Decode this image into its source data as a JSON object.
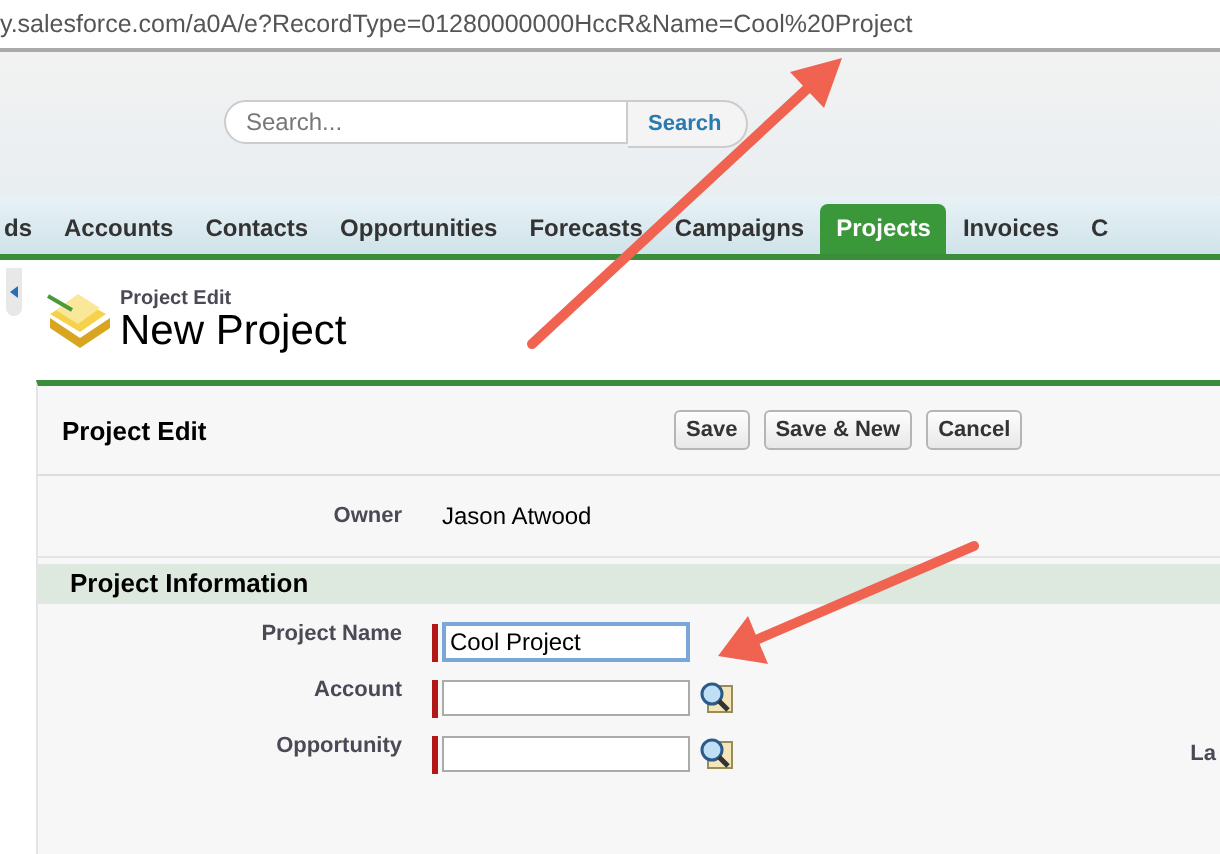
{
  "address_bar": {
    "url": "y.salesforce.com/a0A/e?RecordType=01280000000HccR&Name=Cool%20Project"
  },
  "search": {
    "placeholder": "Search...",
    "button": "Search"
  },
  "tabs": [
    {
      "label": "ds",
      "selected": false
    },
    {
      "label": "Accounts",
      "selected": false
    },
    {
      "label": "Contacts",
      "selected": false
    },
    {
      "label": "Opportunities",
      "selected": false
    },
    {
      "label": "Forecasts",
      "selected": false
    },
    {
      "label": "Campaigns",
      "selected": false
    },
    {
      "label": "Projects",
      "selected": true
    },
    {
      "label": "Invoices",
      "selected": false
    },
    {
      "label": "C",
      "selected": false
    }
  ],
  "page_header": {
    "subtitle": "Project Edit",
    "title": "New Project"
  },
  "edit_panel": {
    "title": "Project Edit",
    "buttons": [
      "Save",
      "Save & New",
      "Cancel"
    ],
    "owner": {
      "label": "Owner",
      "value": "Jason Atwood"
    },
    "section": {
      "title": "Project Information",
      "fields": [
        {
          "label": "Project Name",
          "kind": "text",
          "value": "Cool Project",
          "required": true,
          "focused": true
        },
        {
          "label": "Account",
          "kind": "lookup",
          "required": true,
          "focused": false
        },
        {
          "label": "Opportunity",
          "kind": "lookup",
          "required": true,
          "focused": false,
          "right_label": "La"
        }
      ]
    }
  }
}
